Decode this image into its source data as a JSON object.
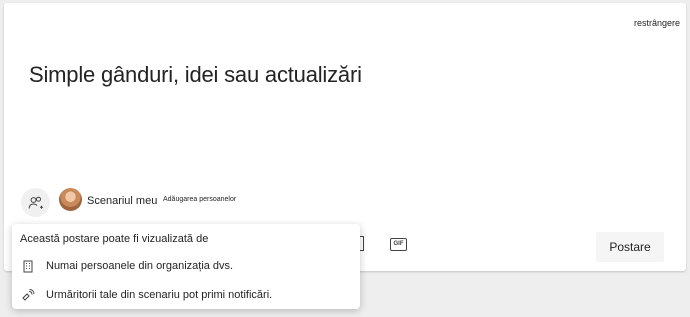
{
  "composer": {
    "collapse_label": "restrângere",
    "placeholder": "Simple gânduri, idei sau actualizări",
    "scenario_label": "Scenariul meu",
    "add_people_label": "Adăugarea persoanelor",
    "post_label": "Postare"
  },
  "popup": {
    "title": "Această postare poate fi vizualizată de",
    "items": [
      {
        "icon": "building-icon",
        "label": "Numai persoanele din organizația dvs."
      },
      {
        "icon": "broadcast-icon",
        "label": "Urmăritorii tale din scenariu pot primi notificări."
      }
    ]
  },
  "toolbar": {
    "gif_label": "GIF"
  },
  "colors": {
    "text": "#242424",
    "background": "#eeeeee",
    "card": "#ffffff",
    "button_bg": "#f5f5f5"
  }
}
